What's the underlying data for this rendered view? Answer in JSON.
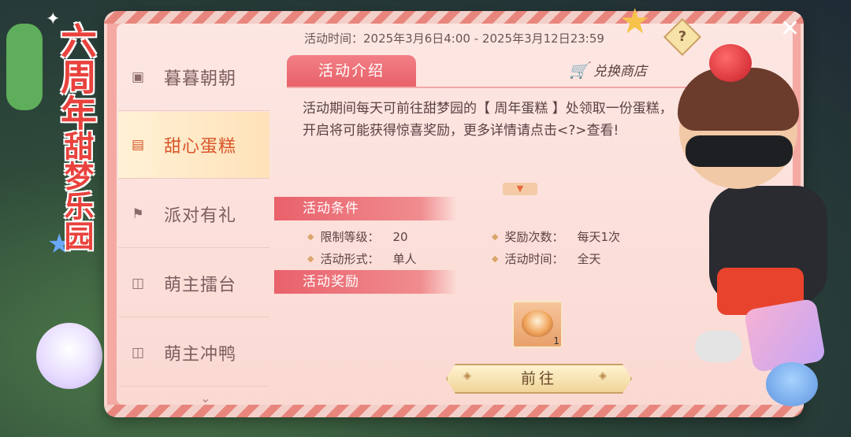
{
  "side_title": {
    "line1": "六周年",
    "line2": "甜梦乐园"
  },
  "sidebar": {
    "items": [
      {
        "label": "暮暮朝朝",
        "icon": "calendar-icon",
        "active": false
      },
      {
        "label": "甜心蛋糕",
        "icon": "cake-box-icon",
        "active": true
      },
      {
        "label": "派对有礼",
        "icon": "flag-icon",
        "active": false
      },
      {
        "label": "萌主擂台",
        "icon": "frame-icon",
        "active": false
      },
      {
        "label": "萌主冲鸭",
        "icon": "frame-icon",
        "active": false
      }
    ]
  },
  "header": {
    "time_text": "活动时间：2025年3月6日4:00 - 2025年3月12日23:59",
    "help_label": "?"
  },
  "intro": {
    "tab_label": "活动介绍",
    "shop_label": "兑换商店",
    "description": "活动期间每天可前往甜梦园的【 周年蛋糕 】处领取一份蛋糕，开启将可能获得惊喜奖励，更多详情请点击<?>查看!"
  },
  "conditions": {
    "title": "活动条件",
    "items": [
      {
        "key": "限制等级：",
        "value": "20"
      },
      {
        "key": "奖励次数：",
        "value": "每天1次"
      },
      {
        "key": "活动形式：",
        "value": "单人"
      },
      {
        "key": "活动时间：",
        "value": "全天"
      }
    ]
  },
  "rewards": {
    "title": "活动奖励",
    "items": [
      {
        "icon": "cake-icon",
        "count": "1"
      }
    ]
  },
  "actions": {
    "goto_label": "前往"
  },
  "colors": {
    "accent": "#e9616b",
    "title_red": "#e9423d",
    "active_text": "#d8562a"
  }
}
